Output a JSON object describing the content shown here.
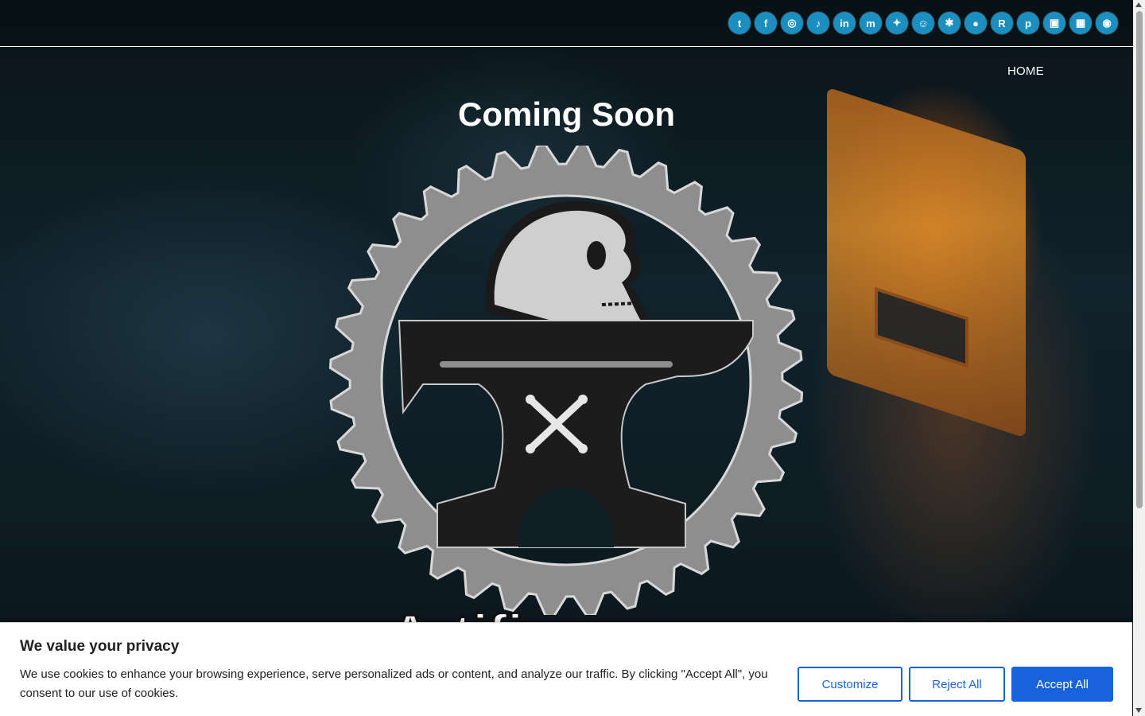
{
  "social": {
    "links": [
      {
        "name": "twitter-icon",
        "glyph": "t"
      },
      {
        "name": "facebook-icon",
        "glyph": "f"
      },
      {
        "name": "instagram-icon",
        "glyph": "◎"
      },
      {
        "name": "tiktok-icon",
        "glyph": "♪"
      },
      {
        "name": "linkedin-icon",
        "glyph": "in"
      },
      {
        "name": "mastodon-icon",
        "glyph": "m"
      },
      {
        "name": "bluesky-icon",
        "glyph": "✦"
      },
      {
        "name": "snapchat-icon",
        "glyph": "☺"
      },
      {
        "name": "myspace-icon",
        "glyph": "✱"
      },
      {
        "name": "reddit-icon",
        "glyph": "●"
      },
      {
        "name": "rumble-icon",
        "glyph": "R"
      },
      {
        "name": "pinterest-icon",
        "glyph": "p"
      },
      {
        "name": "twitch-icon",
        "glyph": "▣"
      },
      {
        "name": "qr-code-icon",
        "glyph": "▦"
      },
      {
        "name": "discord-icon",
        "glyph": "◉"
      }
    ]
  },
  "nav": {
    "home": "HOME"
  },
  "hero": {
    "title": "Coming Soon",
    "bigtext": "Artifi"
  },
  "cookie": {
    "title": "We value your privacy",
    "text": "We use cookies to enhance your browsing experience, serve personalized ads or content, and analyze our traffic. By clicking \"Accept All\", you consent to our use of cookies.",
    "customize": "Customize",
    "reject": "Reject All",
    "accept": "Accept All"
  },
  "colors": {
    "accent": "#1863dc",
    "social_bg": "#1a8fc0"
  }
}
